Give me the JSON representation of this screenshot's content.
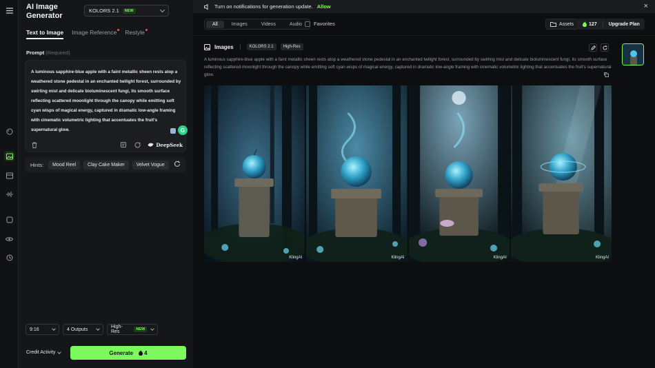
{
  "app": {
    "title": "AI Image Generator",
    "model": "KOLORS 2.1",
    "model_badge": "NEW"
  },
  "rail_icons": [
    "menu-icon",
    "palette-icon",
    "image-icon",
    "video-icon",
    "audio-wave-icon",
    "cube-icon",
    "eye-icon",
    "history-icon"
  ],
  "tabs": [
    {
      "label": "Text to Image",
      "active": true,
      "dot": false
    },
    {
      "label": "Image Reference",
      "active": false,
      "dot": true
    },
    {
      "label": "Restyle",
      "active": false,
      "dot": true
    }
  ],
  "prompt": {
    "label": "Prompt",
    "required": "(Required)",
    "text": "A luminous sapphire-blue apple with a faint metallic sheen rests atop a weathered stone pedestal in an enchanted twilight forest, surrounded by swirling mist and delicate bioluminescent fungi, its smooth surface reflecting scattered moonlight through the canopy while emitting soft cyan wisps of magical energy, captured in dramatic low-angle framing with cinematic volumetric lighting that accentuates the fruit's supernatural glow.",
    "assistant": "DeepSeek"
  },
  "hints": {
    "label": "Hints:",
    "items": [
      "Mood Reel",
      "Clay Cake Maker",
      "Velvet Vogue"
    ]
  },
  "options": {
    "aspect": "9:16",
    "outputs": "4 Outputs",
    "quality": "High-Res",
    "quality_badge": "NEW"
  },
  "footer": {
    "credit_activity": "Credit Activity",
    "generate": "Generate",
    "generate_cost": "4"
  },
  "notification": {
    "text": "Turn on notifications for generation update.",
    "action": "Allow"
  },
  "filters": [
    "All",
    "Images",
    "Videos",
    "Audio"
  ],
  "active_filter": "All",
  "favorites": "Favorites",
  "assets": "Assets",
  "credits": "127",
  "upgrade": "Upgrade Plan",
  "result": {
    "heading": "Images",
    "model": "KOLORS 2.1",
    "quality": "High-Res",
    "prompt": "A luminous sapphire-blue apple with a faint metallic sheen rests atop a weathered stone pedestal in an enchanted twilight forest, surrounded by swirling mist and delicate bioluminescent fungi, its smooth surface reflecting scattered moonlight through the canopy while emitting soft cyan wisps of magical energy, captured in dramatic low-angle framing with cinematic volumetric lighting that accentuates the fruit's supernatural glow.",
    "watermark": "KlingAI"
  },
  "colors": {
    "accent": "#7cf95d",
    "background": "#0d0e10",
    "panel": "#151619"
  }
}
